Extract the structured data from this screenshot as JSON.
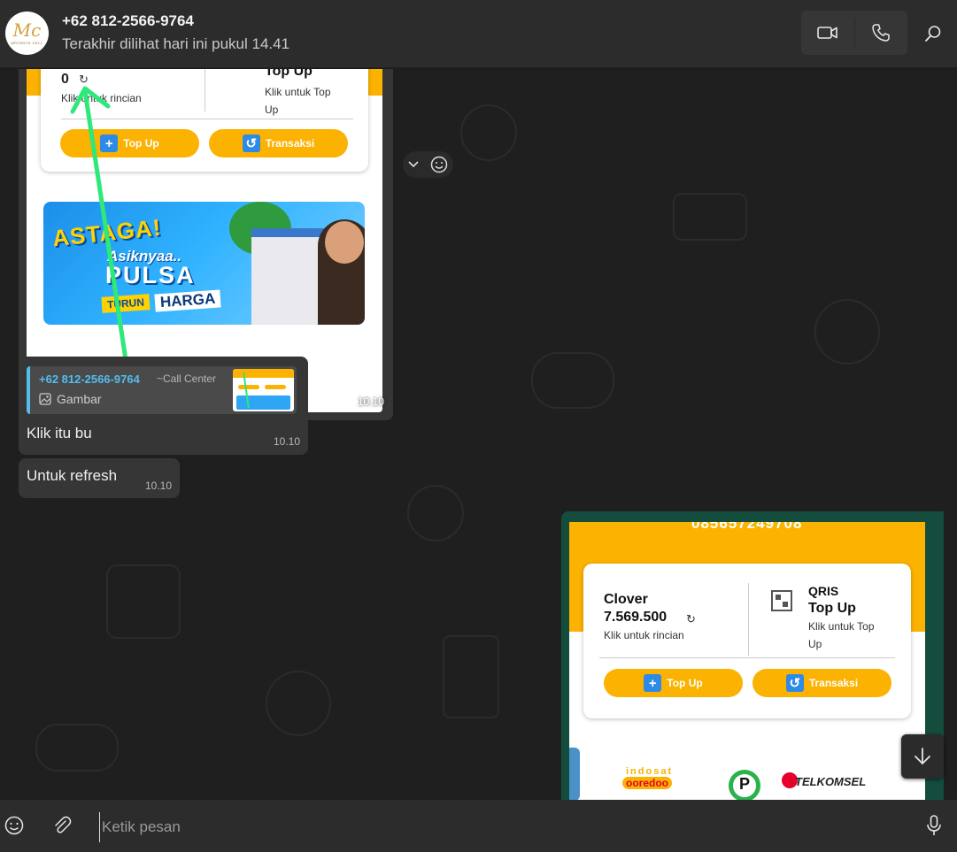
{
  "header": {
    "avatar_text": "Mc",
    "avatar_subtext": "MRTANTE CELL",
    "contact_name": "+62 812-2566-9764",
    "status": "Terakhir dilihat hari ini pukul 14.41",
    "icons": [
      "video-call-icon",
      "voice-call-icon",
      "search-icon"
    ]
  },
  "chat": {
    "image_message": {
      "balance": "0",
      "balance_hint": "Klik untuk rincian",
      "topup_title": "Top Up",
      "topup_hint": "Klik untuk Top Up",
      "button_topup": "Top Up",
      "button_transaksi": "Transaksi",
      "banner_line1": "ASTAGA!",
      "banner_line2": "Asiknyaa..",
      "banner_line3": "PULSA",
      "banner_turun": "TURUN",
      "banner_harga": "HARGA",
      "time": "10.10"
    },
    "quoted_message": {
      "quote_name": "+62 812-2566-9764",
      "quote_tag": "~Call Center",
      "quote_type": "Gambar",
      "text": "Klik itu bu",
      "time": "10.10"
    },
    "refresh_message": {
      "text": "Untuk refresh",
      "time": "10.10"
    },
    "outgoing_image": {
      "phone": "085657249708",
      "name": "Clover",
      "balance": "7.569.500",
      "balance_hint": "Klik untuk rincian",
      "qris": "QRIS",
      "topup_title": "Top Up",
      "topup_hint": "Klik untuk Top Up",
      "button_topup": "Top Up",
      "button_transaksi": "Transaksi",
      "logo_indosat_top": "indosat",
      "logo_indosat_bottom": "ooredoo",
      "logo_telkomsel": "TELKOMSEL"
    }
  },
  "footer": {
    "placeholder": "Ketik pesan"
  },
  "colors": {
    "accent_yellow": "#fbb200",
    "quote_blue": "#53bdeb",
    "outgoing_bubble": "#144d3e",
    "annotation_arrow": "#2ee87a"
  }
}
